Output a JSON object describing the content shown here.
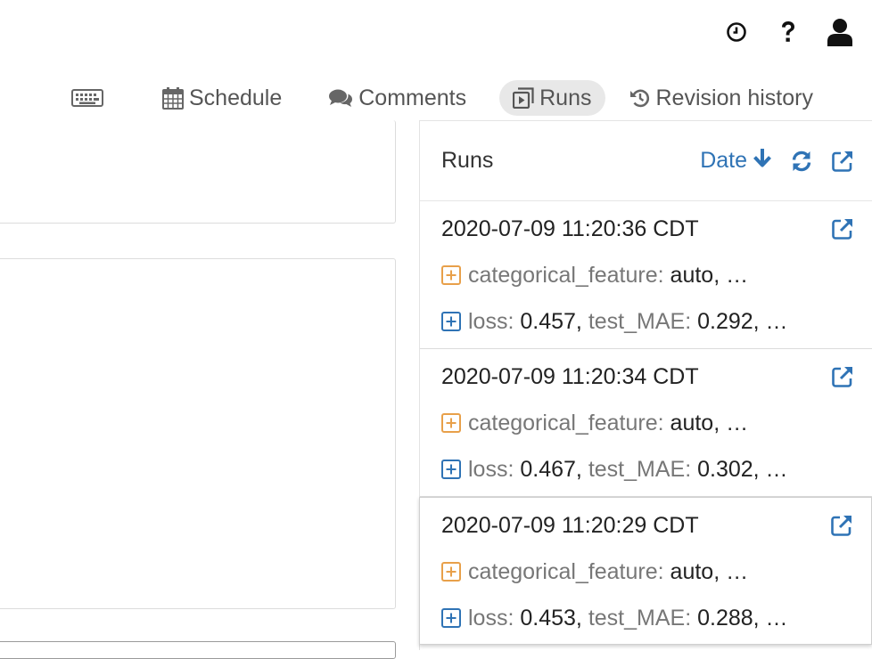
{
  "top_icons": [
    "clock-icon",
    "help-icon",
    "user-icon"
  ],
  "tabs": {
    "keyboard_icon": "keyboard-icon",
    "schedule": "Schedule",
    "comments": "Comments",
    "runs": "Runs",
    "revision_history": "Revision history"
  },
  "runs_panel": {
    "title": "Runs",
    "sort_label": "Date",
    "sort_direction": "descending",
    "accent_color": "#2f73b5",
    "param_color": "#e8a04a",
    "metric_color": "#2f73b5",
    "runs": [
      {
        "timestamp": "2020-07-09 11:20:36 CDT",
        "param_key": "categorical_feature:",
        "param_val": "auto, …",
        "m1_key": "loss:",
        "m1_val": "0.457,",
        "m2_key": "test_MAE:",
        "m2_val": "0.292, …"
      },
      {
        "timestamp": "2020-07-09 11:20:34 CDT",
        "param_key": "categorical_feature:",
        "param_val": "auto, …",
        "m1_key": "loss:",
        "m1_val": "0.467,",
        "m2_key": "test_MAE:",
        "m2_val": "0.302, …"
      },
      {
        "timestamp": "2020-07-09 11:20:29 CDT",
        "param_key": "categorical_feature:",
        "param_val": "auto, …",
        "m1_key": "loss:",
        "m1_val": "0.453,",
        "m2_key": "test_MAE:",
        "m2_val": "0.288, …"
      }
    ]
  }
}
